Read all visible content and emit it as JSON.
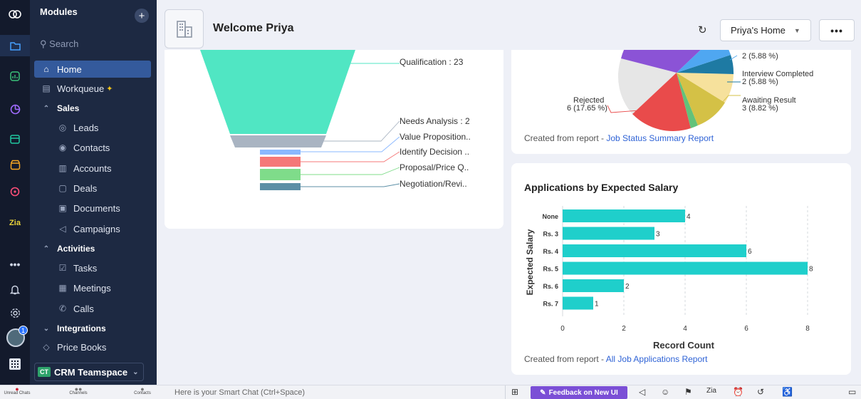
{
  "rail": {
    "icons": [
      "zoho-logo-icon",
      "folder-icon",
      "analytics-icon",
      "pie-chart-icon",
      "calendar-edit-icon",
      "store-icon",
      "search-magnify-icon",
      "zia-icon",
      "more-dots-icon",
      "bell-icon",
      "settings-icon",
      "grid-icon"
    ],
    "zia_label": "Zia",
    "more_label": "•••",
    "notification_count": "1"
  },
  "sidebar": {
    "title": "Modules",
    "plus": "+",
    "search_placeholder": "Search",
    "home": "Home",
    "workqueue": "Workqueue",
    "sales_section": "Sales",
    "sales_items": [
      "Leads",
      "Contacts",
      "Accounts",
      "Deals",
      "Documents",
      "Campaigns"
    ],
    "activities_section": "Activities",
    "activities_items": [
      "Tasks",
      "Meetings",
      "Calls"
    ],
    "integrations_section": "Integrations",
    "price_books": "Price Books",
    "teamspace_badge": "CT",
    "teamspace": "CRM Teamspace"
  },
  "header": {
    "welcome": "Welcome Priya",
    "home_select": "Priya's Home",
    "more": "•••"
  },
  "funnel": {
    "stages": [
      {
        "label": "Qualification : 23",
        "value": 23,
        "color": "#50e6c3"
      },
      {
        "label": "Needs Analysis : 2",
        "value": 2,
        "color": "#a9b4c2"
      },
      {
        "label": "Value Proposition..",
        "value": 1,
        "color": "#8ab8ff"
      },
      {
        "label": "Identify Decision ..",
        "value": 1,
        "color": "#f57878"
      },
      {
        "label": "Proposal/Price Q..",
        "value": 1,
        "color": "#7fdc8a"
      },
      {
        "label": "Negotiation/Revi..",
        "value": 1,
        "color": "#5c8fa6"
      }
    ]
  },
  "pie": {
    "labels": {
      "top": "2 (5.88 %)",
      "interview": "Interview Completed",
      "interview_val": "2 (5.88 %)",
      "rejected": "Rejected",
      "rejected_val": "6 (17.65 %)",
      "awaiting": "Awaiting Result",
      "awaiting_val": "3 (8.82 %)"
    },
    "created_prefix": "Created from report - ",
    "created_link": "Job Status Summary Report"
  },
  "chart_data": {
    "type": "bar",
    "orientation": "horizontal",
    "title": "Applications by Expected Salary",
    "xlabel": "Record Count",
    "ylabel": "Expected Salary",
    "categories": [
      "None",
      "Rs. 3",
      "Rs. 4",
      "Rs. 5",
      "Rs. 6",
      "Rs. 7"
    ],
    "values": [
      4,
      3,
      6,
      8,
      2,
      1
    ],
    "xlim": [
      0,
      9
    ],
    "xticks": [
      "0",
      "2",
      "4",
      "6",
      "8"
    ],
    "color": "#1fcfcb",
    "created_prefix": "Created from report - ",
    "created_link": "All Job Applications Report"
  },
  "bottombar": {
    "unread_chats": "Unread Chats",
    "channels": "Channels",
    "contacts": "Contacts",
    "smart_chat": "Here is your Smart Chat (Ctrl+Space)",
    "feedback": "Feedback on New UI"
  }
}
